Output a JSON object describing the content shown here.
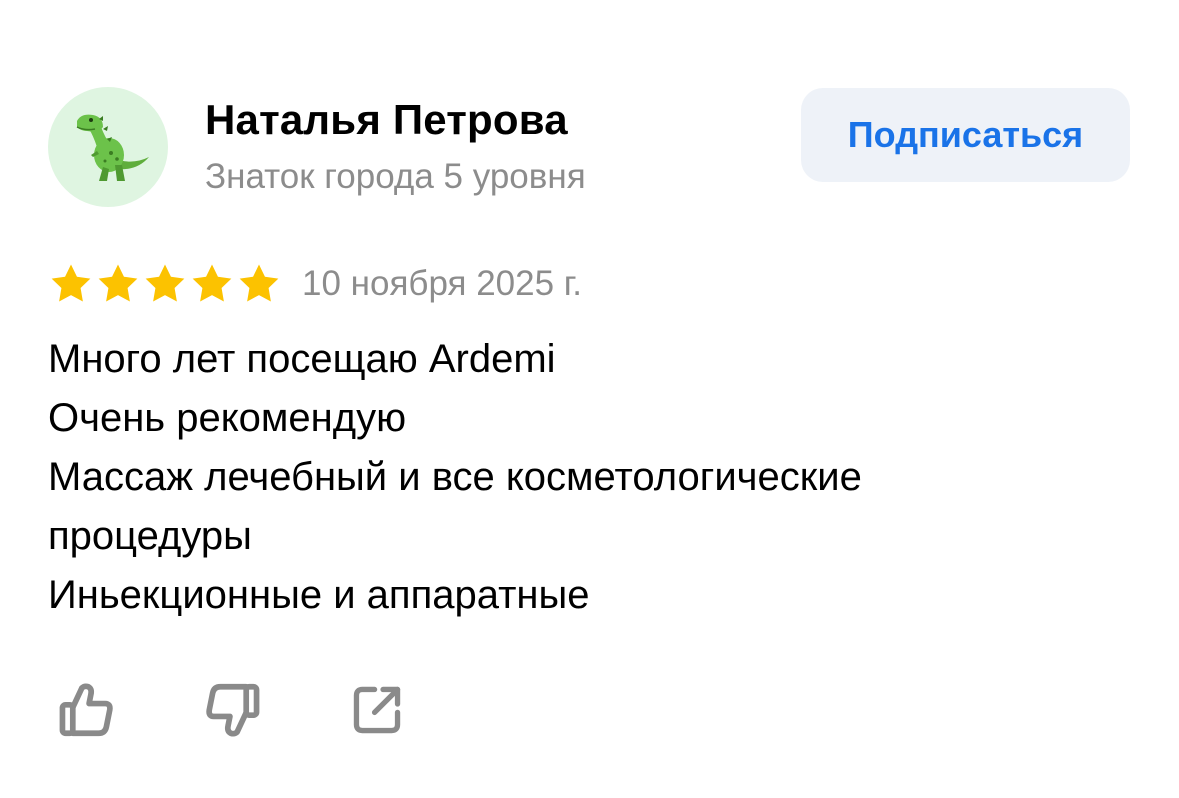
{
  "author": {
    "name": "Наталья Петрова",
    "level": "Знаток города 5 уровня",
    "avatar_icon": "dinosaur-icon"
  },
  "subscribe": {
    "label": "Подписаться"
  },
  "review": {
    "rating": 5,
    "rating_max": 5,
    "date": "10 ноября 2025 г.",
    "lines": [
      "Много лет посещаю Ardemi",
      "Очень рекомендую",
      "Массаж лечебный и все косметологические",
      "процедуры",
      "Иньекционные и аппаратные"
    ]
  },
  "actions": {
    "icons": [
      "thumbs-up-icon",
      "thumbs-down-icon",
      "share-icon"
    ]
  },
  "colors": {
    "star": "#fcc200",
    "accent": "#1a73e8",
    "button_bg": "#eef2f8",
    "secondary_text": "#8c8c8c",
    "avatar_bg": "#dff5e1"
  }
}
